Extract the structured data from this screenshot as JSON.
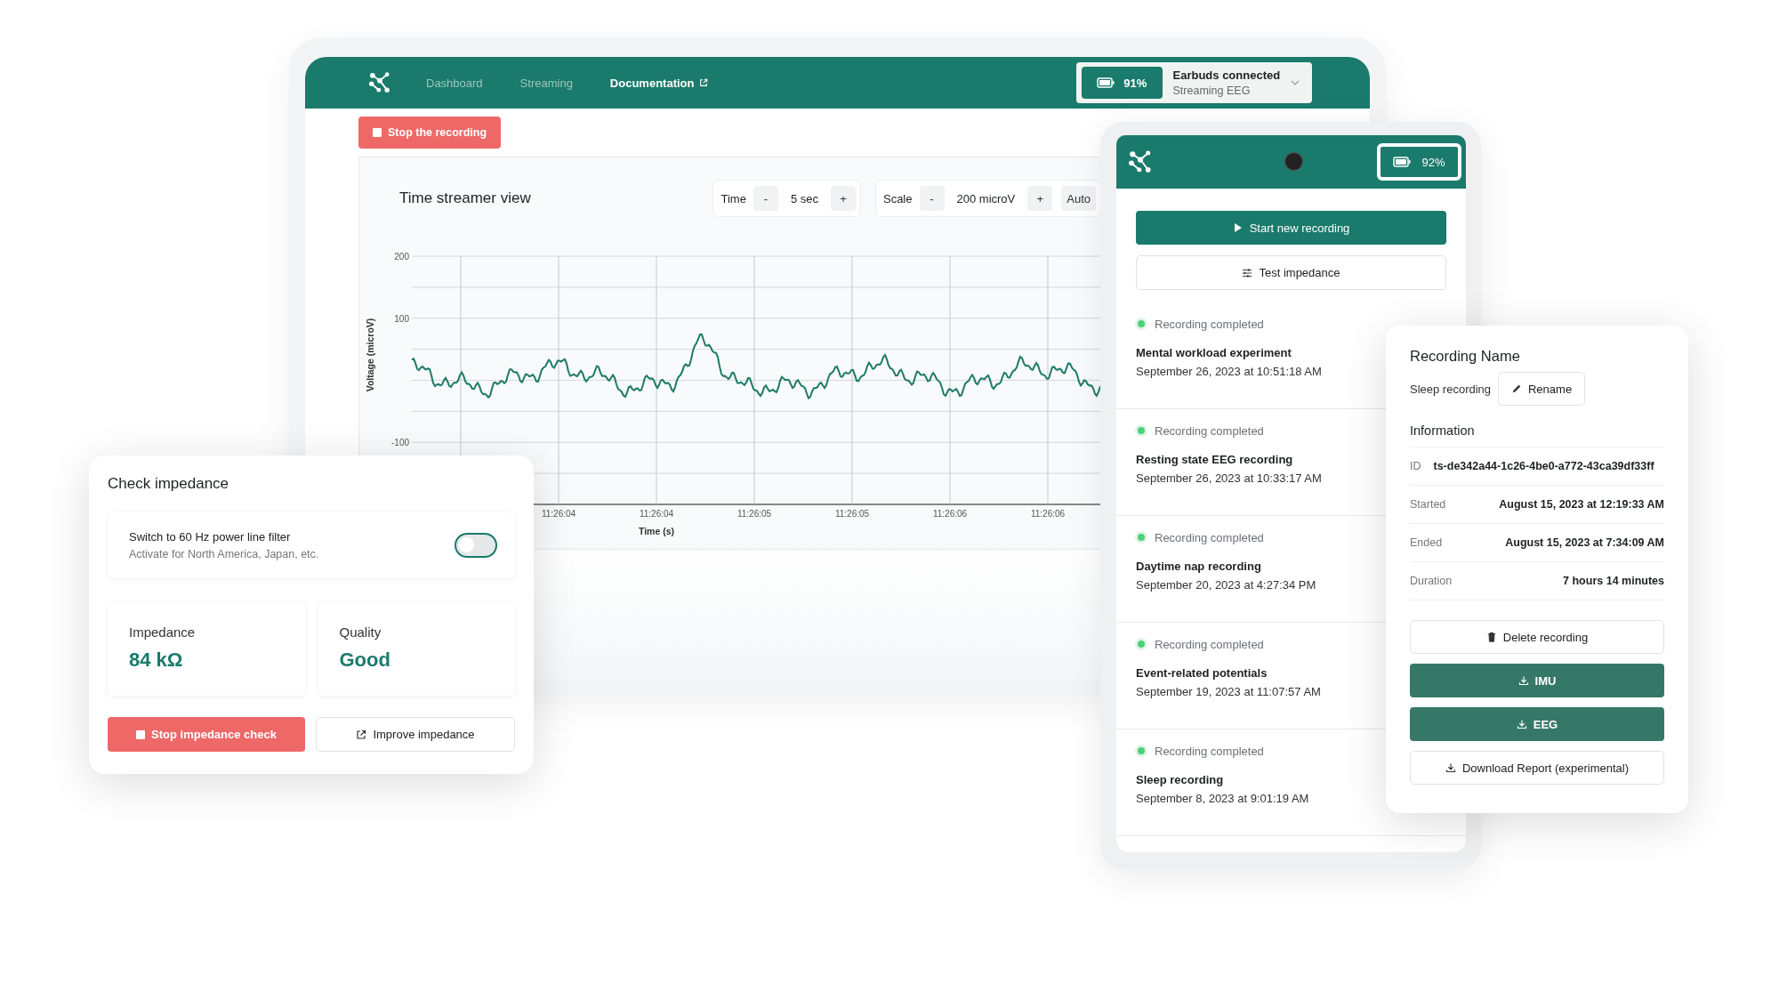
{
  "desktop": {
    "nav": [
      {
        "label": "Dashboard",
        "selected": false,
        "external_link": false
      },
      {
        "label": "Streaming",
        "selected": false,
        "external_link": false
      },
      {
        "label": "Documentation",
        "selected": true,
        "external_link": true
      }
    ],
    "battery": "91%",
    "device_status": "Earbuds connected",
    "device_substatus": "Streaming EEG",
    "stop_button": "Stop the recording",
    "chart": {
      "title": "Time streamer view",
      "controls": [
        {
          "label": "Time",
          "minus": "-",
          "value": "5 sec",
          "plus": "+"
        },
        {
          "label": "Scale",
          "minus": "-",
          "value": "200 microV",
          "plus": "+",
          "extra": "Auto"
        }
      ],
      "y_ticks": [
        "200",
        "100",
        "-100"
      ],
      "x_ticks": [
        "11:26:04",
        "11:26:04",
        "11:26:05",
        "11:26:05",
        "11:26:06",
        "11:26:06"
      ],
      "ylabel": "Voltage (microV)",
      "xlabel": "Time (s)"
    }
  },
  "impedance": {
    "title": "Check impedance",
    "filter_label": "Switch to 60 Hz power line filter",
    "filter_hint": "Activate for North America, Japan, etc.",
    "filter_on": false,
    "stats": [
      {
        "label": "Impedance",
        "value": "84 kΩ"
      },
      {
        "label": "Quality",
        "value": "Good"
      }
    ],
    "stop_button": "Stop impedance check",
    "improve_button": "Improve impedance"
  },
  "phone": {
    "battery": "92%",
    "start_button": "Start new recording",
    "test_button": "Test impedance",
    "recordings": [
      {
        "status": "Recording completed",
        "name": "Mental workload experiment",
        "date": "September 26, 2023 at 10:51:18 AM"
      },
      {
        "status": "Recording completed",
        "name": "Resting state EEG recording",
        "date": "September 26, 2023 at 10:33:17 AM"
      },
      {
        "status": "Recording completed",
        "name": "Daytime nap recording",
        "date": "September 20, 2023 at 4:27:34 PM"
      },
      {
        "status": "Recording completed",
        "name": "Event-related potentials",
        "date": "September 19, 2023 at 11:07:57 AM"
      },
      {
        "status": "Recording completed",
        "name": "Sleep recording",
        "date": "September 8, 2023 at 9:01:19 AM"
      }
    ]
  },
  "recording_details": {
    "title": "Recording Name",
    "name": "Sleep recording",
    "rename_button": "Rename",
    "info_title": "Information",
    "info": [
      {
        "label": "ID",
        "value": "ts-de342a44-1c26-4be0-a772-43ca39df33ff"
      },
      {
        "label": "Started",
        "value": "August 15, 2023 at 12:19:33 AM"
      },
      {
        "label": "Ended",
        "value": "August 15, 2023 at 7:34:09 AM"
      },
      {
        "label": "Duration",
        "value": "7 hours 14 minutes"
      }
    ],
    "delete_button": "Delete recording",
    "imu_button": "IMU",
    "eeg_button": "EEG",
    "report_button": "Download Report (experimental)"
  }
}
